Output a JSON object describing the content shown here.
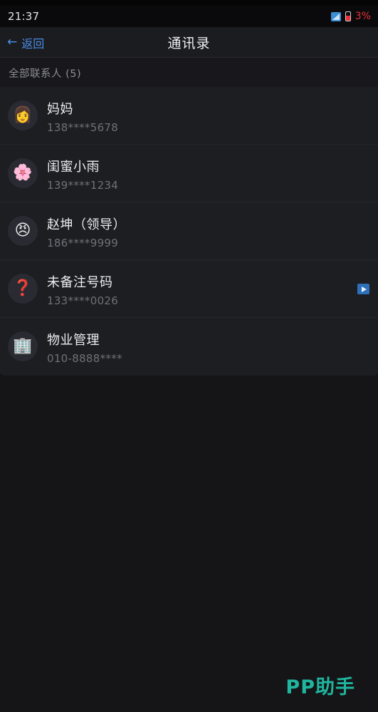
{
  "status_bar": {
    "time": "21:37",
    "battery_text": "3%",
    "battery_color": "#e8313a"
  },
  "nav": {
    "back_label": "返回",
    "title": "通讯录",
    "accent_color": "#4a8ee8"
  },
  "section": {
    "header": "全部联系人 (5)"
  },
  "contacts": [
    {
      "avatar": "👩",
      "name": "妈妈",
      "phone": "138****5678",
      "has_play": false
    },
    {
      "avatar": "🌸",
      "name": "闺蜜小雨",
      "phone": "139****1234",
      "has_play": false
    },
    {
      "avatar": "😠",
      "name": "赵坤（领导）",
      "phone": "186****9999",
      "has_play": false
    },
    {
      "avatar": "❓",
      "name": "未备注号码",
      "phone": "133****0026",
      "has_play": true
    },
    {
      "avatar": "🏢",
      "name": "物业管理",
      "phone": "010-8888****",
      "has_play": false
    }
  ],
  "watermark": {
    "text": "PP助手",
    "color": "#1fb59e"
  }
}
